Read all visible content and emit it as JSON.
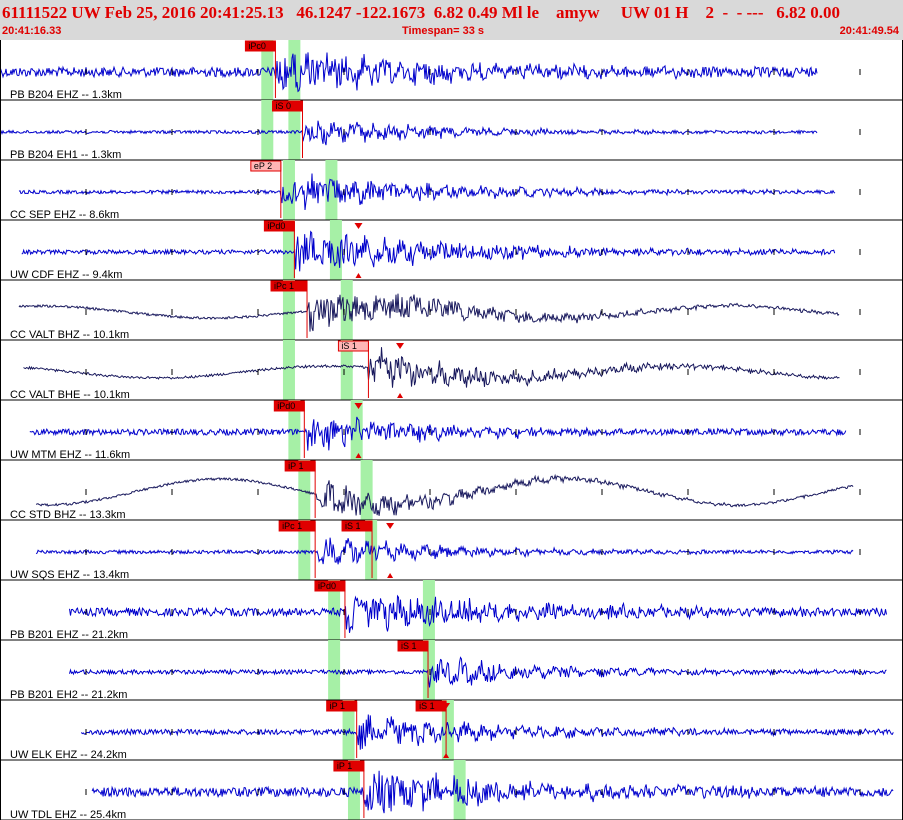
{
  "header": {
    "title": "61111522 UW Feb 25, 2016 20:41:25.13   46.1247 -122.1673  6.82 0.49 Ml le    amyw     UW 01 H    2  -  - ---   6.82 0.00",
    "start_time": "20:41:16.33",
    "timespan": "Timespan=  33 s",
    "end_time": "20:41:49.54"
  },
  "colors": {
    "header_bg": "#d9d9d9",
    "title_text": "#e00000",
    "trace_blue": "#0000cc",
    "trace_dark": "#1a1a5e",
    "pick_fill": "#e00000",
    "pick_unconfirmed": "#ffb6b6",
    "window_green": "#a6f0a6"
  },
  "traces": [
    {
      "label": "PB B204 EHZ -- 1.3km",
      "color": "dark_blue",
      "style": "blue",
      "start": 0.0,
      "end": 0.905,
      "amp": 0.2,
      "onset": 0.305,
      "burst": 0.8,
      "windows": [
        0.296,
        0.326
      ],
      "picks": [
        {
          "text": "iPc0",
          "pos": 0.305,
          "filled": true
        }
      ],
      "markers": []
    },
    {
      "label": "PB B204 EH1 -- 1.3km",
      "color": "dark_blue",
      "style": "blue",
      "start": 0.0,
      "end": 0.905,
      "amp": 0.02,
      "onset": 0.335,
      "burst": 0.5,
      "windows": [
        0.296,
        0.326
      ],
      "picks": [
        {
          "text": "iS 0",
          "pos": 0.335,
          "filled": true
        }
      ],
      "markers": []
    },
    {
      "label": "CC SEP EHZ -- 8.6km",
      "color": "dark_blue",
      "style": "blue",
      "start": 0.021,
      "end": 0.925,
      "amp": 0.03,
      "onset": 0.311,
      "burst": 0.7,
      "windows": [
        0.32,
        0.367
      ],
      "picks": [
        {
          "text": "eP 2",
          "pos": 0.311,
          "filled": false
        }
      ],
      "markers": []
    },
    {
      "label": "UW CDF EHZ -- 9.4km",
      "color": "dark_blue",
      "style": "blue",
      "start": 0.024,
      "end": 0.925,
      "amp": 0.05,
      "onset": 0.326,
      "burst": 0.8,
      "windows": [
        0.32,
        0.372
      ],
      "picks": [
        {
          "text": "iPd0",
          "pos": 0.326,
          "filled": true
        }
      ],
      "markers": [
        0.397
      ]
    },
    {
      "label": "CC VALT BHZ -- 10.1km",
      "color": "dark",
      "style": "dark",
      "start": 0.021,
      "end": 0.93,
      "amp": 0.15,
      "onset": 0.34,
      "burst": 0.75,
      "windows": [
        0.32,
        0.384
      ],
      "picks": [
        {
          "text": "iPc 1",
          "pos": 0.34,
          "filled": true
        }
      ],
      "markers": []
    },
    {
      "label": "CC VALT BHE -- 10.1km",
      "color": "dark",
      "style": "dark",
      "start": 0.026,
      "end": 0.93,
      "amp": 0.2,
      "onset": 0.408,
      "burst": 0.7,
      "windows": [
        0.32,
        0.384
      ],
      "picks": [
        {
          "text": "iS 1",
          "pos": 0.408,
          "filled": false
        }
      ],
      "markers": [
        0.443
      ]
    },
    {
      "label": "UW MTM EHZ -- 11.6km",
      "color": "dark_blue",
      "style": "blue",
      "start": 0.033,
      "end": 0.937,
      "amp": 0.1,
      "onset": 0.337,
      "burst": 0.6,
      "windows": [
        0.326,
        0.395
      ],
      "picks": [
        {
          "text": "iPd0",
          "pos": 0.337,
          "filled": true
        }
      ],
      "markers": [
        0.397
      ]
    },
    {
      "label": "CC STD BHZ -- 13.3km",
      "color": "dark",
      "style": "dark",
      "start": 0.04,
      "end": 0.945,
      "amp": 0.25,
      "onset": 0.349,
      "burst": 0.6,
      "windows": [
        0.337,
        0.406
      ],
      "picks": [
        {
          "text": "iP 1",
          "pos": 0.349,
          "filled": true
        }
      ],
      "markers": []
    },
    {
      "label": "UW SQS EHZ -- 13.4km",
      "color": "dark_blue",
      "style": "blue",
      "start": 0.04,
      "end": 0.945,
      "amp": 0.03,
      "onset": 0.349,
      "burst": 0.5,
      "windows": [
        0.337,
        0.411
      ],
      "picks": [
        {
          "text": "iPc 1",
          "pos": 0.349,
          "filled": true
        },
        {
          "text": "iS 1",
          "pos": 0.412,
          "filled": true
        }
      ],
      "markers": [
        0.432
      ]
    },
    {
      "label": "PB B201 EHZ -- 21.2km",
      "color": "dark_blue",
      "style": "blue",
      "start": 0.077,
      "end": 0.982,
      "amp": 0.15,
      "onset": 0.382,
      "burst": 0.8,
      "windows": [
        0.37,
        0.475
      ],
      "picks": [
        {
          "text": "iPd0",
          "pos": 0.382,
          "filled": true
        }
      ],
      "markers": []
    },
    {
      "label": "PB B201 EH2 -- 21.2km",
      "color": "dark_blue",
      "style": "blue",
      "start": 0.077,
      "end": 0.982,
      "amp": 0.05,
      "onset": 0.474,
      "burst": 0.5,
      "windows": [
        0.37,
        0.475
      ],
      "picks": [
        {
          "text": "iS 1",
          "pos": 0.474,
          "filled": true
        }
      ],
      "markers": []
    },
    {
      "label": "UW ELK EHZ -- 24.2km",
      "color": "dark_blue",
      "style": "blue",
      "start": 0.09,
      "end": 0.99,
      "amp": 0.08,
      "onset": 0.395,
      "burst": 0.6,
      "windows": [
        0.386,
        0.496
      ],
      "picks": [
        {
          "text": "iP 1",
          "pos": 0.395,
          "filled": true
        },
        {
          "text": "iS 1",
          "pos": 0.494,
          "filled": true
        }
      ],
      "markers": [
        0.494
      ]
    },
    {
      "label": "UW TDL EHZ -- 25.4km",
      "color": "dark_blue",
      "style": "blue",
      "start": 0.102,
      "end": 0.99,
      "amp": 0.2,
      "onset": 0.403,
      "burst": 0.8,
      "windows": [
        0.392,
        0.509
      ],
      "picks": [
        {
          "text": "iP 1",
          "pos": 0.403,
          "filled": true
        }
      ],
      "markers": []
    }
  ]
}
